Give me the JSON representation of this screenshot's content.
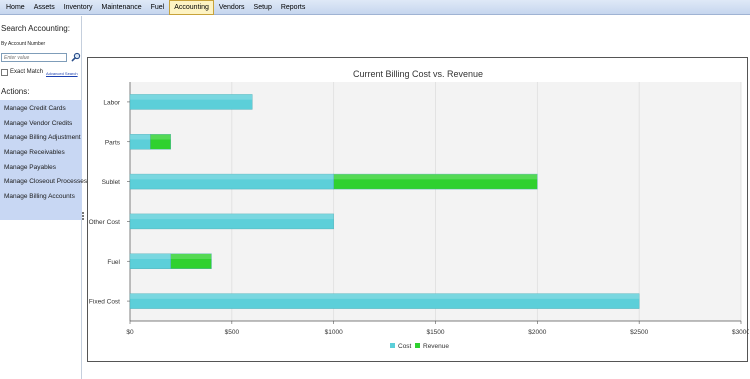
{
  "menubar": {
    "items": [
      {
        "label": "Home",
        "active": false
      },
      {
        "label": "Assets",
        "active": false
      },
      {
        "label": "Inventory",
        "active": false
      },
      {
        "label": "Maintenance",
        "active": false
      },
      {
        "label": "Fuel",
        "active": false
      },
      {
        "label": "Accounting",
        "active": true
      },
      {
        "label": "Vendors",
        "active": false
      },
      {
        "label": "Setup",
        "active": false
      },
      {
        "label": "Reports",
        "active": false
      }
    ]
  },
  "sidebar": {
    "title": "Search Accounting:",
    "search_by_label": "By Account Number",
    "search_placeholder": "Enter value",
    "search_icon": "magnifier-icon",
    "exact_match_label": "Exact Match",
    "advanced_search_label": "Advanced Search",
    "actions_title": "Actions:",
    "actions": [
      {
        "label": "Manage Credit Cards"
      },
      {
        "label": "Manage Vendor Credits"
      },
      {
        "label": "Manage Billing Adjustment"
      },
      {
        "label": "Manage Receivables"
      },
      {
        "label": "Manage Payables"
      },
      {
        "label": "Manage Closeout Processes"
      },
      {
        "label": "Manage Billing Accounts"
      }
    ],
    "panel_color": "#c8d7f3"
  },
  "chart_data": {
    "type": "bar",
    "orientation": "horizontal",
    "stacked": true,
    "title": "Current Billing Cost vs. Revenue",
    "categories": [
      "Labor",
      "Parts",
      "Sublet",
      "Other Cost",
      "Fuel",
      "Fixed Cost"
    ],
    "series": [
      {
        "name": "Cost",
        "color": "#5ccfd9",
        "values": [
          600,
          100,
          1000,
          1000,
          200,
          2500
        ]
      },
      {
        "name": "Revenue",
        "color": "#2fd12f",
        "values": [
          0,
          100,
          1000,
          0,
          200,
          0
        ]
      }
    ],
    "xlim": [
      0,
      3000
    ],
    "xticks": [
      "$0",
      "$500",
      "$1000",
      "$1500",
      "$2000",
      "$2500",
      "$3000"
    ],
    "grid": true,
    "legend": "bottom-center"
  }
}
